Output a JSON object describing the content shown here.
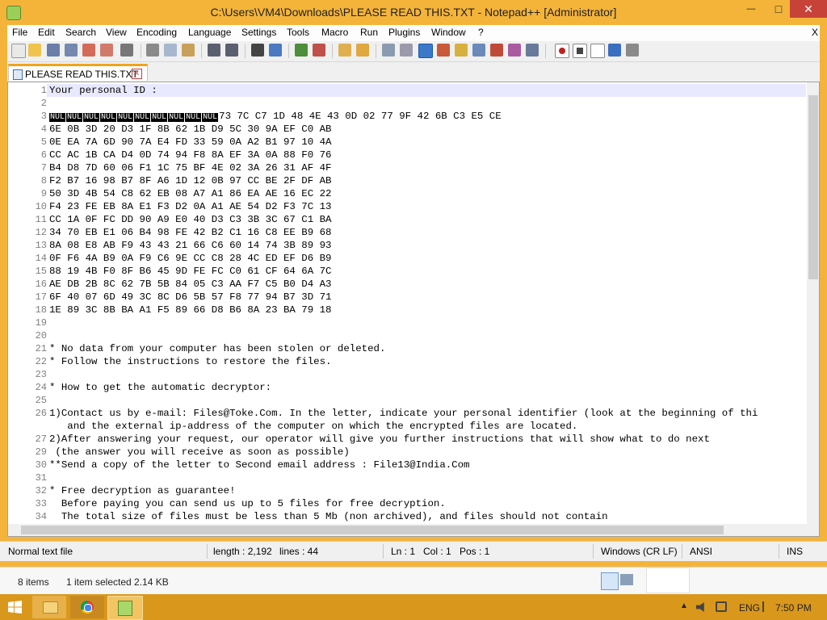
{
  "window": {
    "title": "C:\\Users\\VM4\\Downloads\\PLEASE READ THIS.TXT - Notepad++ [Administrator]",
    "app_icon": "notepadpp-icon",
    "accent_color": "#f4b43a",
    "close_label": "✕",
    "minimize_label": "—",
    "maximize_label": "□"
  },
  "menu": {
    "items": [
      "File",
      "Edit",
      "Search",
      "View",
      "Encoding",
      "Language",
      "Settings",
      "Tools",
      "Macro",
      "Run",
      "Plugins",
      "Window",
      "?"
    ],
    "close_x": "X"
  },
  "tab": {
    "label": "PLEASE READ THIS.TXT",
    "close_label": "x"
  },
  "editor": {
    "nul_token": "NUL",
    "line3_rest": "73 7C C7 1D 48 4E 43 0D 02 77 9F 42 6B C3 E5 CE",
    "lines": [
      {
        "n": "1",
        "text": "Your personal ID :"
      },
      {
        "n": "2",
        "text": ""
      },
      {
        "n": "3",
        "text": ""
      },
      {
        "n": "4",
        "text": "6E 0B 3D 20 D3 1F 8B 62 1B D9 5C 30 9A EF C0 AB"
      },
      {
        "n": "5",
        "text": "0E EA 7A 6D 90 7A E4 FD 33 59 0A A2 B1 97 10 4A"
      },
      {
        "n": "6",
        "text": "CC AC 1B CA D4 0D 74 94 F8 8A EF 3A 0A 88 F0 76"
      },
      {
        "n": "7",
        "text": "B4 D8 7D 60 06 F1 1C 75 BF 4E 02 3A 26 31 AF 4F"
      },
      {
        "n": "8",
        "text": "F2 B7 16 98 B7 8F A6 1D 12 0B 97 CC BE 2F DF AB"
      },
      {
        "n": "9",
        "text": "50 3D 4B 54 C8 62 EB 08 A7 A1 86 EA AE 16 EC 22"
      },
      {
        "n": "10",
        "text": "F4 23 FE EB 8A E1 F3 D2 0A A1 AE 54 D2 F3 7C 13"
      },
      {
        "n": "11",
        "text": "CC 1A 0F FC DD 90 A9 E0 40 D3 C3 3B 3C 67 C1 BA"
      },
      {
        "n": "12",
        "text": "34 70 EB E1 06 B4 98 FE 42 B2 C1 16 C8 EE B9 68"
      },
      {
        "n": "13",
        "text": "8A 08 E8 AB F9 43 43 21 66 C6 60 14 74 3B 89 93"
      },
      {
        "n": "14",
        "text": "0F F6 4A B9 0A F9 C6 9E CC C8 28 4C ED EF D6 B9"
      },
      {
        "n": "15",
        "text": "88 19 4B F0 8F B6 45 9D FE FC C0 61 CF 64 6A 7C"
      },
      {
        "n": "16",
        "text": "AE DB 2B 8C 62 7B 5B 84 05 C3 AA F7 C5 B0 D4 A3"
      },
      {
        "n": "17",
        "text": "6F 40 07 6D 49 3C 8C D6 5B 57 F8 77 94 B7 3D 71"
      },
      {
        "n": "18",
        "text": "1E 89 3C 8B BA A1 F5 89 66 D8 B6 8A 23 BA 79 18"
      },
      {
        "n": "19",
        "text": ""
      },
      {
        "n": "20",
        "text": ""
      },
      {
        "n": "21",
        "text": "* No data from your computer has been stolen or deleted."
      },
      {
        "n": "22",
        "text": "* Follow the instructions to restore the files."
      },
      {
        "n": "23",
        "text": ""
      },
      {
        "n": "24",
        "text": "* How to get the automatic decryptor:"
      },
      {
        "n": "25",
        "text": ""
      },
      {
        "n": "26",
        "text": "1)Contact us by e-mail: Files@Toke.Com. In the letter, indicate your personal identifier (look at the beginning of thi"
      },
      {
        "n": "",
        "text": "   and the external ip-address of the computer on which the encrypted files are located."
      },
      {
        "n": "27",
        "text": "2)After answering your request, our operator will give you further instructions that will show what to do next"
      },
      {
        "n": "29",
        "text": " (the answer you will receive as soon as possible)"
      },
      {
        "n": "30",
        "text": "**Send a copy of the letter to Second email address : File13@India.Com"
      },
      {
        "n": "31",
        "text": ""
      },
      {
        "n": "32",
        "text": "* Free decryption as guarantee!"
      },
      {
        "n": "33",
        "text": "  Before paying you can send us up to 5 files for free decryption."
      },
      {
        "n": "34",
        "text": "  The total size of files must be less than 5 Mb (non archived), and files should not contain"
      }
    ]
  },
  "status": {
    "file_type": "Normal text file",
    "length": "length : 2,192",
    "lines": "lines : 44",
    "ln": "Ln : 1",
    "col": "Col : 1",
    "pos": "Pos : 1",
    "eol": "Windows (CR LF)",
    "encoding": "ANSI",
    "mode": "INS"
  },
  "explorer": {
    "items": "8 items",
    "selected": "1 item selected  2.14 KB"
  },
  "taskbar": {
    "language": "ENG",
    "time": "7:50 PM"
  }
}
